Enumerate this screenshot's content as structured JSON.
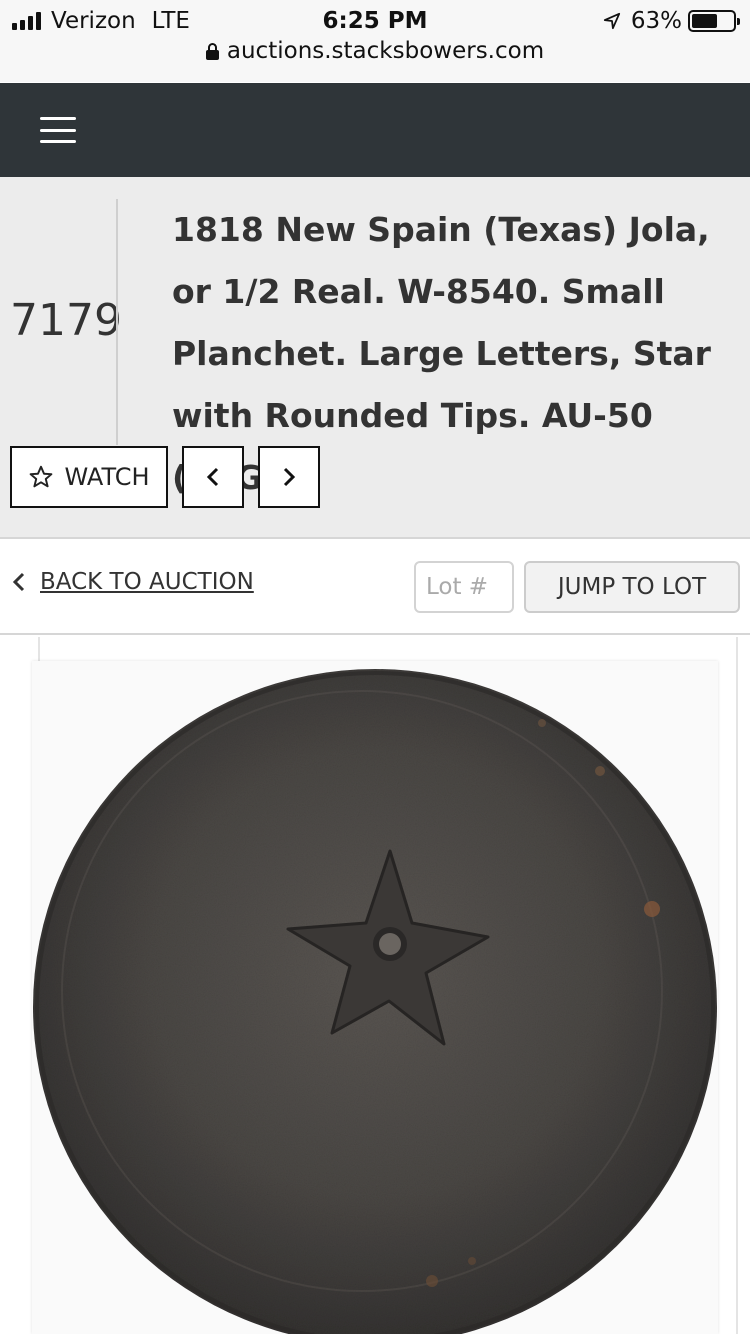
{
  "status_bar": {
    "carrier": "Verizon",
    "network": "LTE",
    "time": "6:25 PM",
    "battery_percent": "63%",
    "battery_level": 0.63,
    "icons": [
      "signal-icon",
      "location-arrow-icon",
      "battery-icon"
    ]
  },
  "browser": {
    "url": "auctions.stacksbowers.com",
    "icons": [
      "lock-icon"
    ]
  },
  "navbar": {
    "icons": [
      "hamburger-menu-icon"
    ],
    "background": "#2f3539"
  },
  "lot": {
    "number": "7179",
    "title": "1818 New Spain (Texas) Jola, or 1/2 Real. W-8540. Small Planchet. Large Letters, Star with Rounded Tips. AU-50 (PCGS).",
    "watch_label": "WATCH",
    "icons": [
      "star-outline-icon",
      "chevron-left-icon",
      "chevron-right-icon"
    ]
  },
  "navigation": {
    "back_label": "BACK TO AUCTION",
    "lot_input_placeholder": "Lot #",
    "jump_label": "JUMP TO LOT",
    "icons": [
      "chevron-left-icon"
    ]
  },
  "image": {
    "subject": "coin-photo",
    "colors": {
      "coin": "#4a4744",
      "star": "#3a3735",
      "card_bg": "#fafafa"
    }
  }
}
